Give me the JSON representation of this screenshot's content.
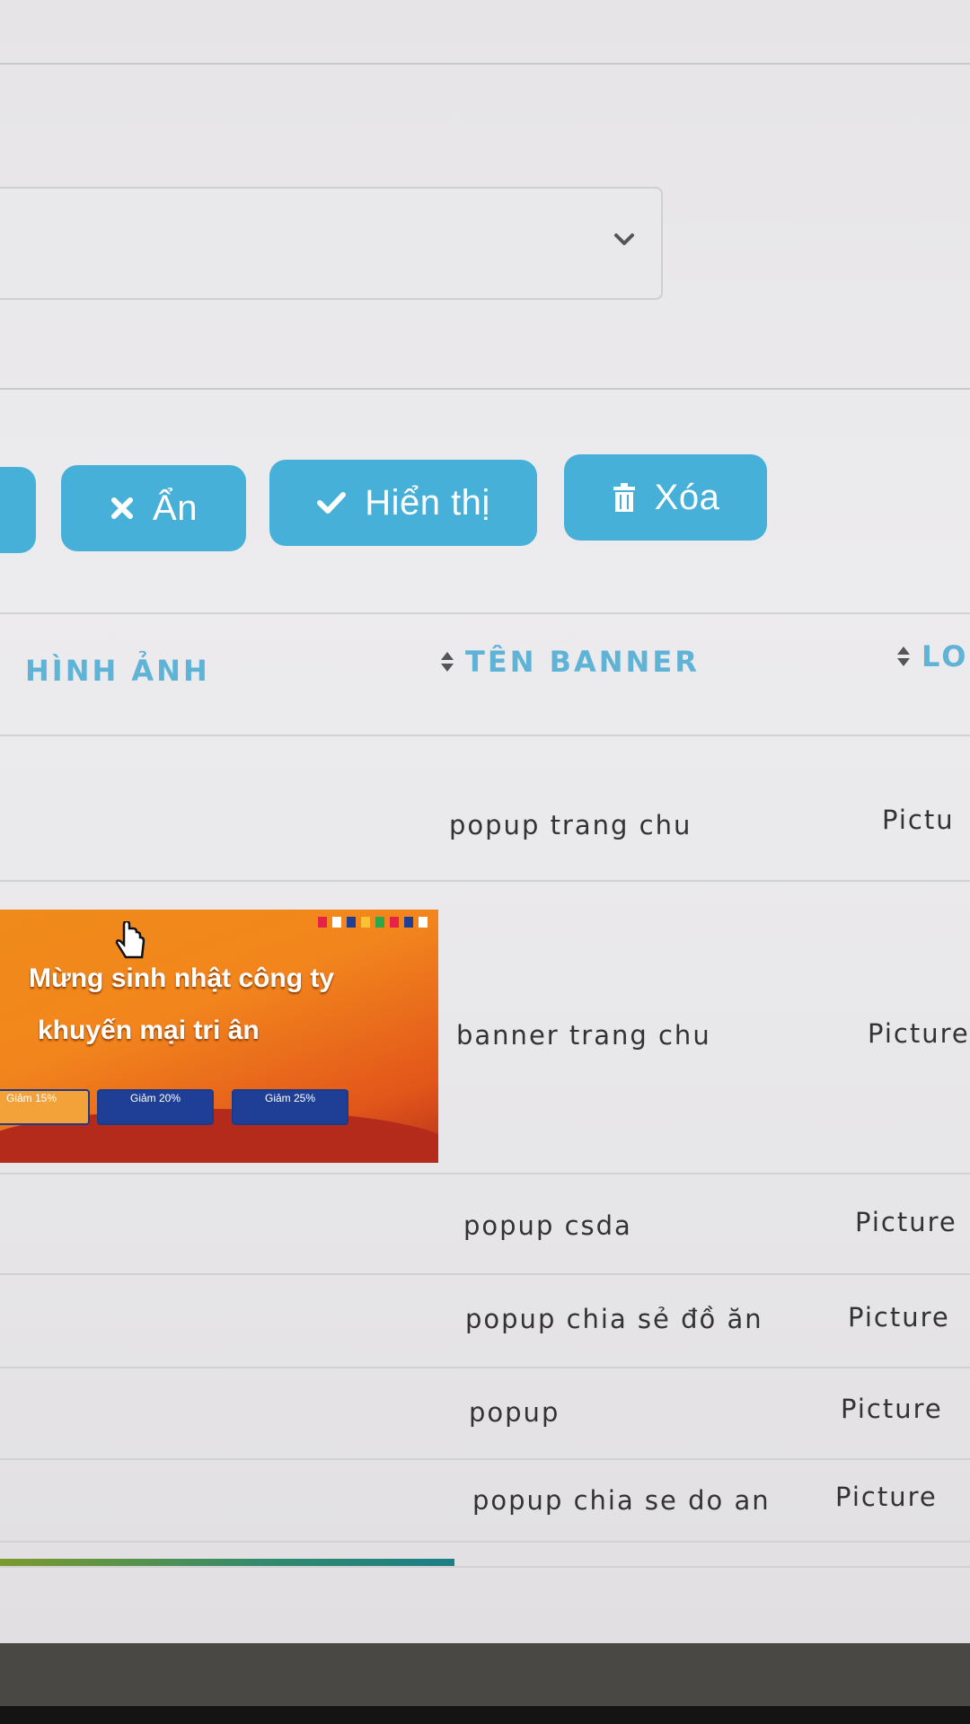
{
  "toolbar": {
    "hide_label": "Ẩn",
    "show_label": "Hiển thị",
    "delete_label": "Xóa"
  },
  "table": {
    "columns": [
      "HÌNH ẢNH",
      "TÊN BANNER",
      "LO"
    ],
    "rows": [
      {
        "name": "popup trang chu",
        "type": "Pictu"
      },
      {
        "name": "banner trang chu",
        "type": "Picture"
      },
      {
        "name": "popup csda",
        "type": "Picture"
      },
      {
        "name": "popup chia sẻ đồ ăn",
        "type": "Picture"
      },
      {
        "name": "popup",
        "type": "Picture"
      },
      {
        "name": "popup chia se do an",
        "type": "Picture"
      }
    ]
  },
  "banner": {
    "title_line1": "Mừng sinh nhật công ty",
    "title_line2": "khuyến mại tri ân",
    "coupons": [
      "Giảm 15%",
      "Giảm 20%",
      "Giảm 25%"
    ]
  },
  "colors": {
    "accent": "#47b0d9",
    "header_text": "#5fb3d6"
  }
}
